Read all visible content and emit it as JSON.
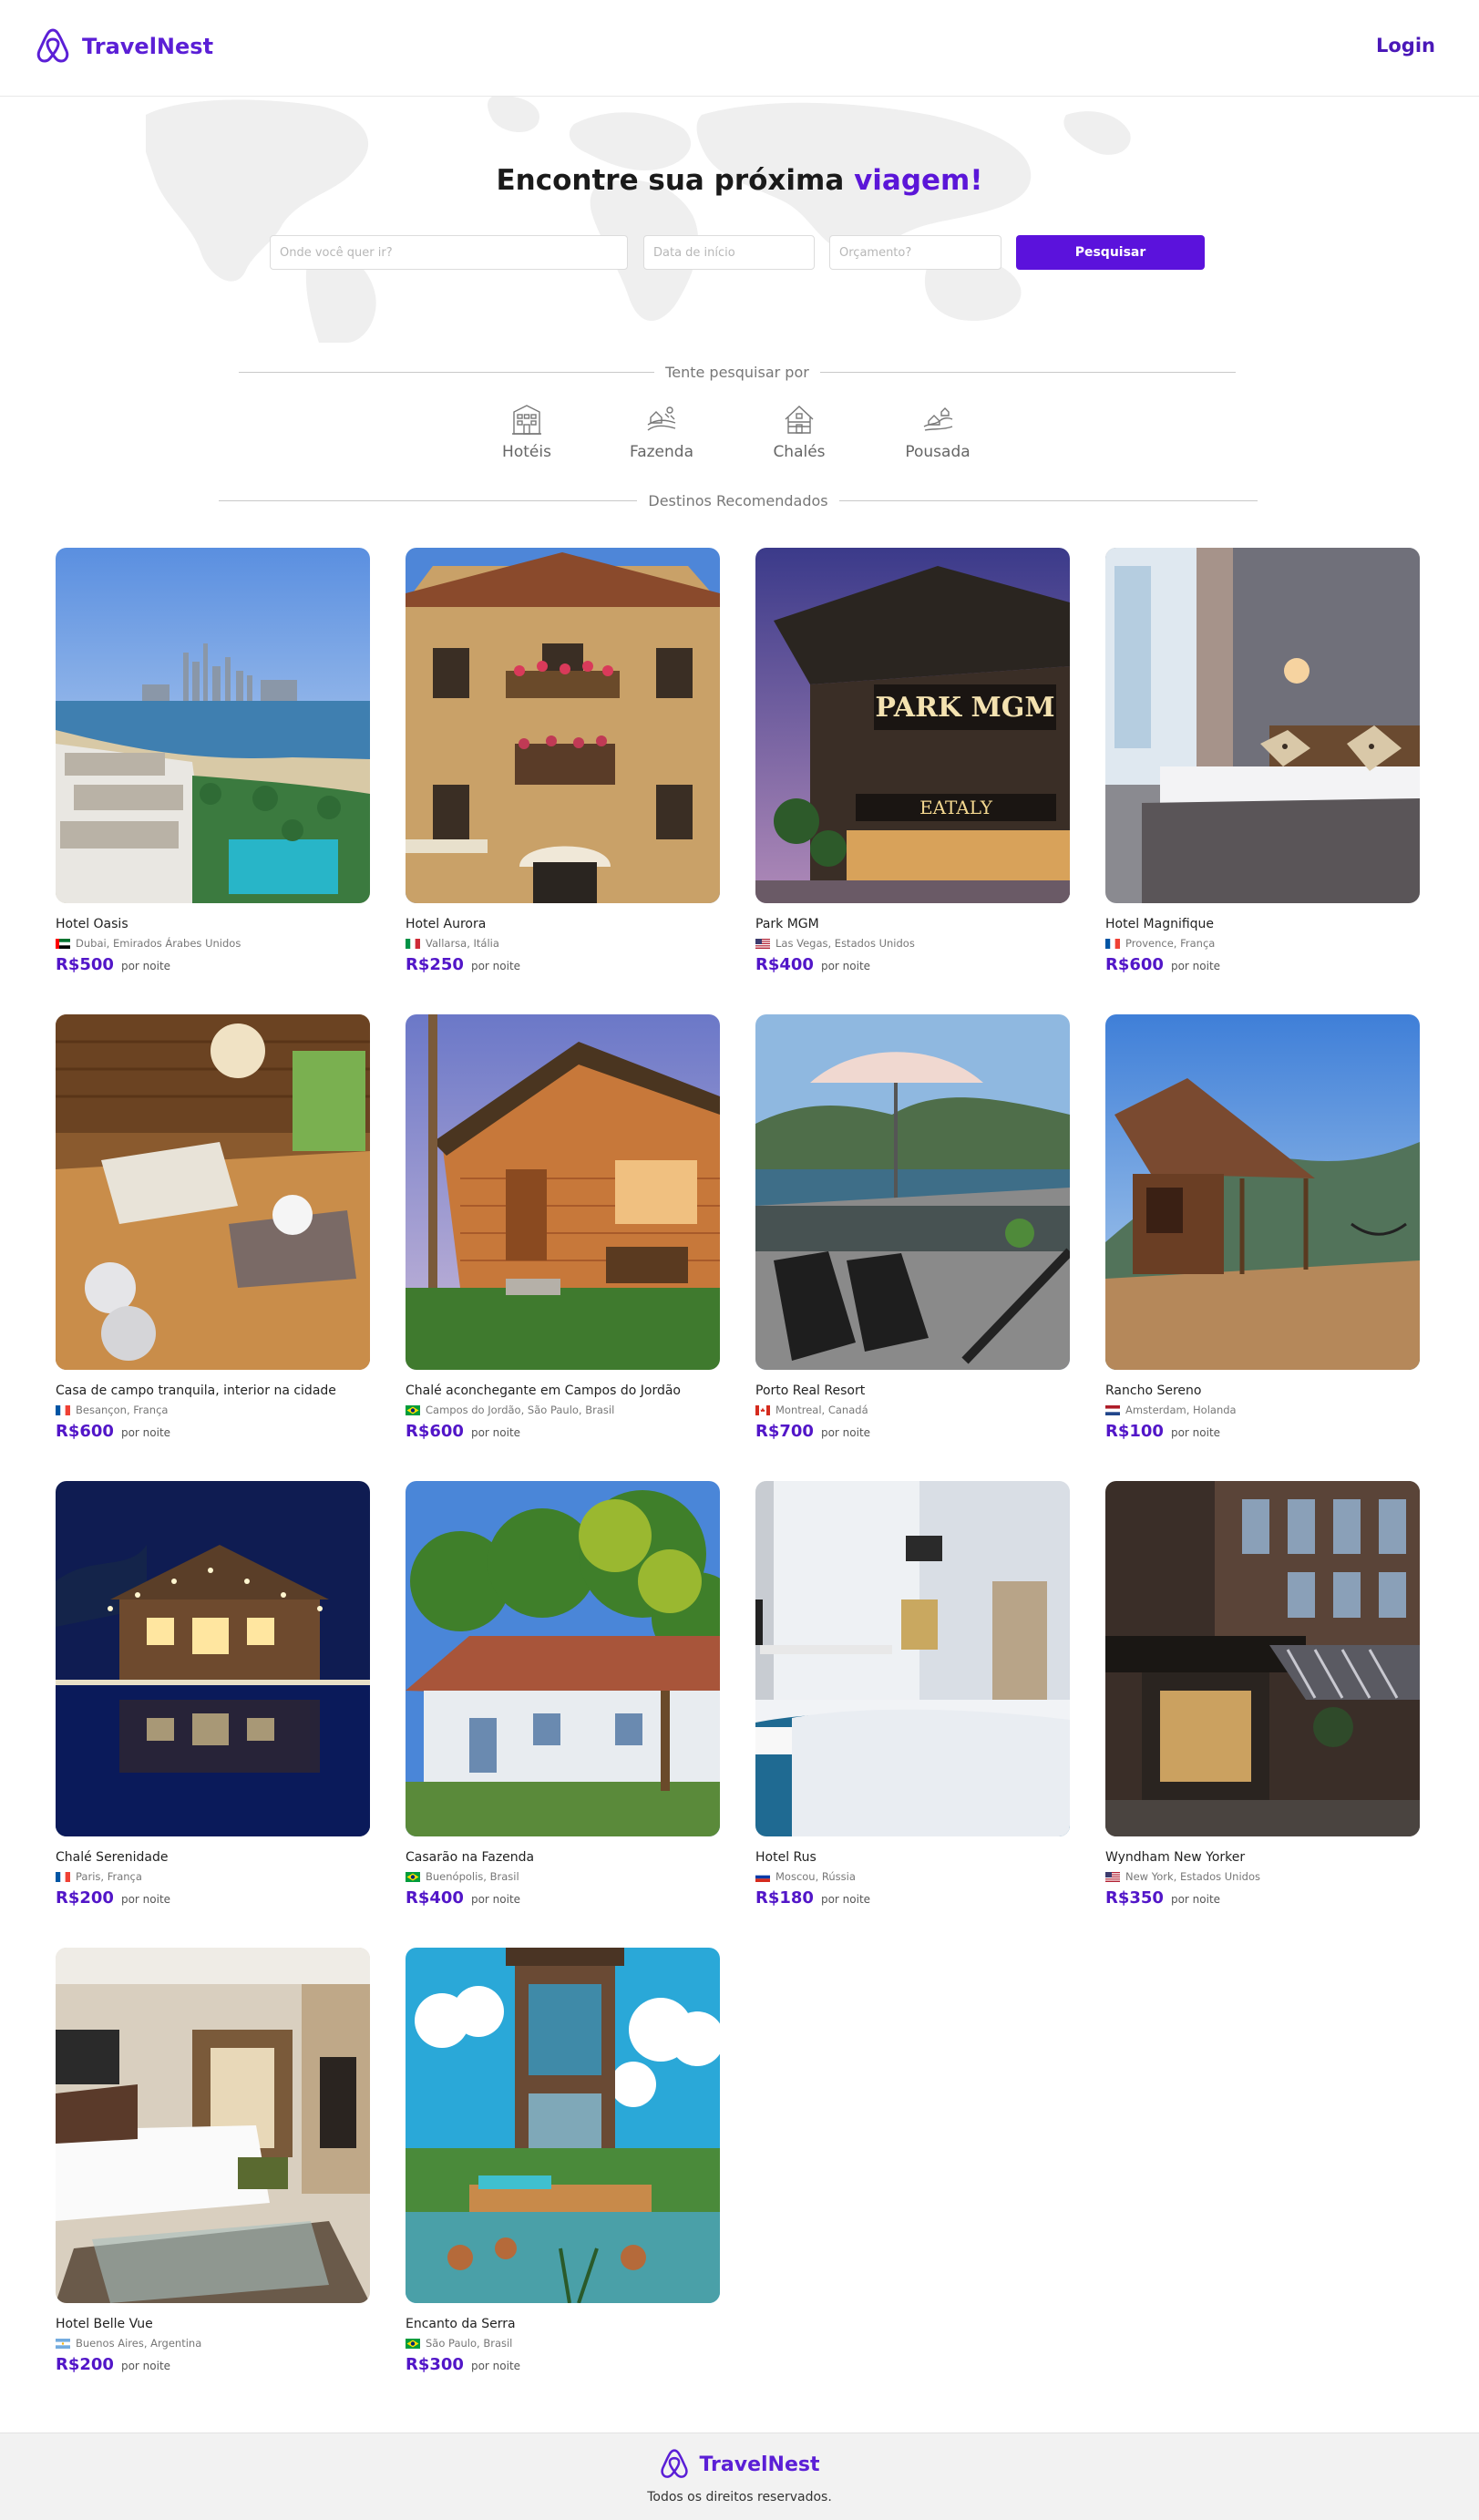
{
  "header": {
    "brand": "TravelNest",
    "login_label": "Login"
  },
  "hero": {
    "title_prefix": "Encontre sua próxima",
    "title_accent": "viagem!",
    "destination_placeholder": "Onde você quer ir?",
    "date_placeholder": "Data de início",
    "budget_placeholder": "Orçamento?",
    "search_button": "Pesquisar"
  },
  "try_search": {
    "label": "Tente pesquisar por",
    "categories": [
      {
        "label": "Hotéis",
        "icon": "hotel-icon"
      },
      {
        "label": "Fazenda",
        "icon": "farm-icon"
      },
      {
        "label": "Chalés",
        "icon": "chalet-icon"
      },
      {
        "label": "Pousada",
        "icon": "inn-icon"
      }
    ]
  },
  "recommended": {
    "label": "Destinos Recomendados",
    "per_night": "por noite",
    "listings": [
      {
        "name": "Hotel Oasis",
        "location": "Dubai, Emirados Árabes Unidos",
        "flag": "uae",
        "price": "R$500"
      },
      {
        "name": "Hotel Aurora",
        "location": "Vallarsa, Itália",
        "flag": "italy",
        "price": "R$250"
      },
      {
        "name": "Park MGM",
        "location": "Las Vegas, Estados Unidos",
        "flag": "usa",
        "price": "R$400"
      },
      {
        "name": "Hotel Magnifique",
        "location": "Provence, França",
        "flag": "france",
        "price": "R$600"
      },
      {
        "name": "Casa de campo tranquila, interior na cidade",
        "location": "Besançon, França",
        "flag": "france",
        "price": "R$600"
      },
      {
        "name": "Chalé aconchegante em Campos do Jordão",
        "location": "Campos do Jordão, São Paulo, Brasil",
        "flag": "brazil",
        "price": "R$600"
      },
      {
        "name": "Porto Real Resort",
        "location": "Montreal, Canadá",
        "flag": "canada",
        "price": "R$700"
      },
      {
        "name": "Rancho Sereno",
        "location": "Amsterdam, Holanda",
        "flag": "netherlands",
        "price": "R$100"
      },
      {
        "name": "Chalé Serenidade",
        "location": "Paris, França",
        "flag": "france",
        "price": "R$200"
      },
      {
        "name": "Casarão na Fazenda",
        "location": "Buenópolis, Brasil",
        "flag": "brazil",
        "price": "R$400"
      },
      {
        "name": "Hotel Rus",
        "location": "Moscou, Rússia",
        "flag": "russia",
        "price": "R$180"
      },
      {
        "name": "Wyndham New Yorker",
        "location": "New York, Estados Unidos",
        "flag": "usa",
        "price": "R$350"
      },
      {
        "name": "Hotel Belle Vue",
        "location": "Buenos Aires, Argentina",
        "flag": "argentina",
        "price": "R$200"
      },
      {
        "name": "Encanto da Serra",
        "location": "São Paulo, Brasil",
        "flag": "brazil",
        "price": "R$300"
      }
    ]
  },
  "footer": {
    "brand": "TravelNest",
    "copyright": "Todos os direitos reservados."
  },
  "colors": {
    "brand": "#5b1fd6",
    "button": "#5b12dc",
    "price": "#5216c8"
  }
}
